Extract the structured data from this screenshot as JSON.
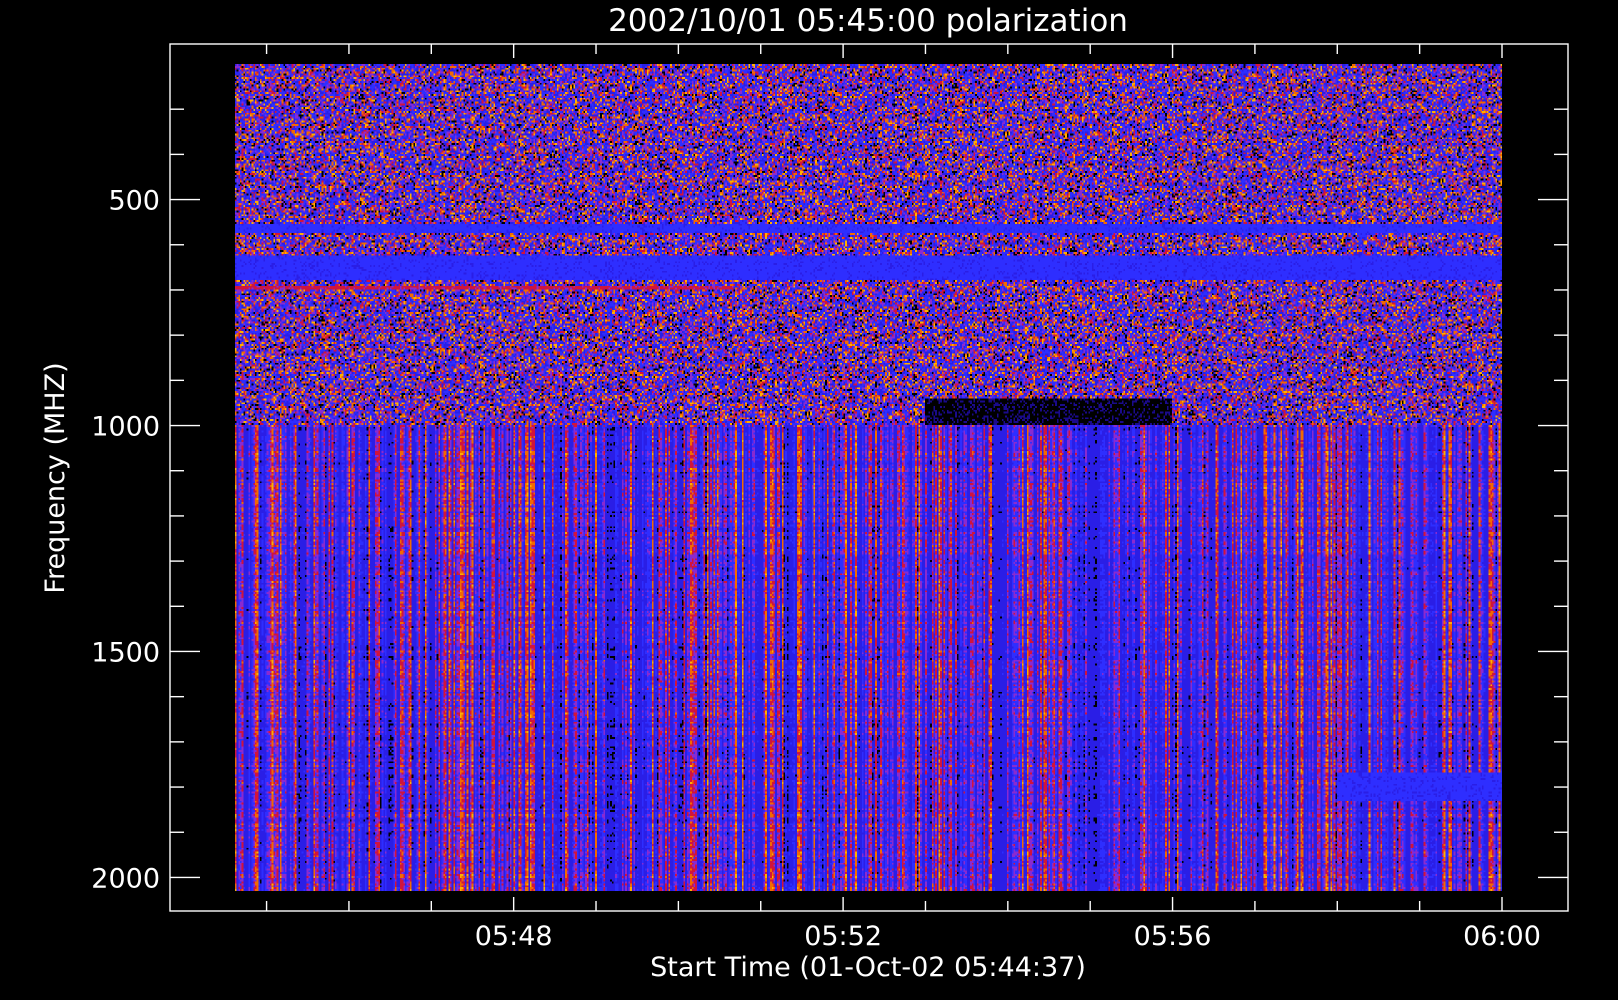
{
  "chart_data": {
    "type": "heatmap",
    "title": "2002/10/01 05:45:00 polarization",
    "xlabel": "Start Time (01-Oct-02 05:44:37)",
    "ylabel": "Frequency (MHZ)",
    "x_range": [
      "05:44:37",
      "06:00:00"
    ],
    "y_range_mhz": [
      200,
      2030
    ],
    "y_axis_inverted": true,
    "x_ticks": [
      {
        "label": "05:48",
        "value": "05:48:00"
      },
      {
        "label": "05:52",
        "value": "05:52:00"
      },
      {
        "label": "05:56",
        "value": "05:56:00"
      },
      {
        "label": "06:00",
        "value": "06:00:00"
      }
    ],
    "y_ticks": [
      {
        "label": "500",
        "value": 500
      },
      {
        "label": "1000",
        "value": 1000
      },
      {
        "label": "1500",
        "value": 1500
      },
      {
        "label": "2000",
        "value": 2000
      }
    ],
    "grid": false,
    "legend": "none",
    "colormap": [
      "#000000",
      "#1a0a8c",
      "#2a1ee6",
      "#2e2eff",
      "#8a2ad0",
      "#d0143c",
      "#f26a00",
      "#ffb000",
      "#ffe070",
      "#ffffff"
    ],
    "background": "#000000",
    "notable_features": [
      {
        "freq_mhz": [
          555,
          575
        ],
        "time": [
          "05:44:37",
          "06:00:00"
        ],
        "description": "steady blue band"
      },
      {
        "freq_mhz": [
          625,
          680
        ],
        "time": [
          "05:44:37",
          "06:00:00"
        ],
        "description": "steady blue band"
      },
      {
        "freq_mhz": [
          690,
          700
        ],
        "time": [
          "05:44:37",
          "05:50:40"
        ],
        "description": "red streak"
      },
      {
        "freq_mhz": [
          940,
          1000
        ],
        "time": [
          "05:53:00",
          "05:56:00"
        ],
        "description": "dark band"
      },
      {
        "freq_mhz": [
          1770,
          1830
        ],
        "time": [
          "05:58:00",
          "06:00:00"
        ],
        "description": "solid blue block"
      }
    ]
  }
}
